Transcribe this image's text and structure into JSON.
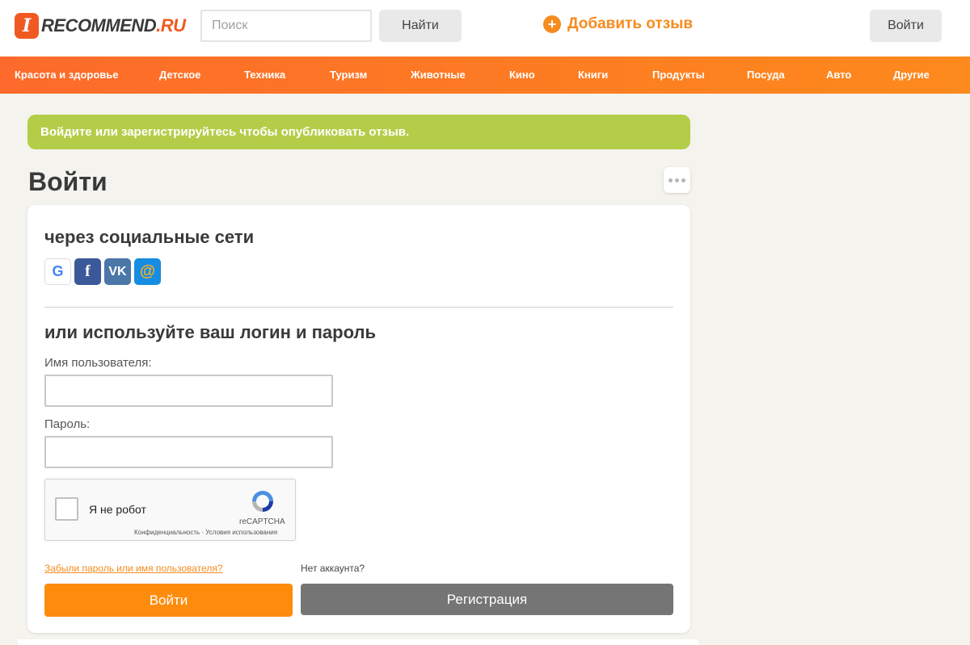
{
  "header": {
    "logo_letter": "I",
    "logo_main": "RECOMMEND",
    "logo_suffix": ".RU",
    "search_placeholder": "Поиск",
    "search_button": "Найти",
    "add_review_label": "Добавить отзыв",
    "login_button": "Войти"
  },
  "nav": {
    "items": [
      "Красота и здоровье",
      "Детское",
      "Техника",
      "Туризм",
      "Животные",
      "Кино",
      "Книги",
      "Продукты",
      "Посуда",
      "Авто",
      "Другие"
    ]
  },
  "notice": "Войдите или зарегистрируйтесь чтобы опубликовать отзыв.",
  "page_title": "Войти",
  "social": {
    "title": "через социальные сети",
    "icons": [
      "google-icon",
      "facebook-icon",
      "vk-icon",
      "mailru-icon"
    ],
    "google_glyph": "G",
    "fb_glyph": "f",
    "vk_glyph": "VK",
    "mail_glyph": "@"
  },
  "login_form": {
    "title": "или используйте ваш логин и пароль",
    "username_label": "Имя пользователя:",
    "password_label": "Пароль:",
    "captcha_label": "Я не робот",
    "captcha_brand": "reCAPTCHA",
    "captcha_terms": "Конфиденциальность · Условия использования",
    "forgot_link": "Забыли пароль или имя пользователя?",
    "no_account": "Нет аккаунта?",
    "submit_button": "Войти",
    "register_button": "Регистрация"
  },
  "colors": {
    "brand_orange": "#f68b1f",
    "logo_red": "#f05a22",
    "notice_green": "#b4cd48",
    "register_gray": "#757575"
  }
}
